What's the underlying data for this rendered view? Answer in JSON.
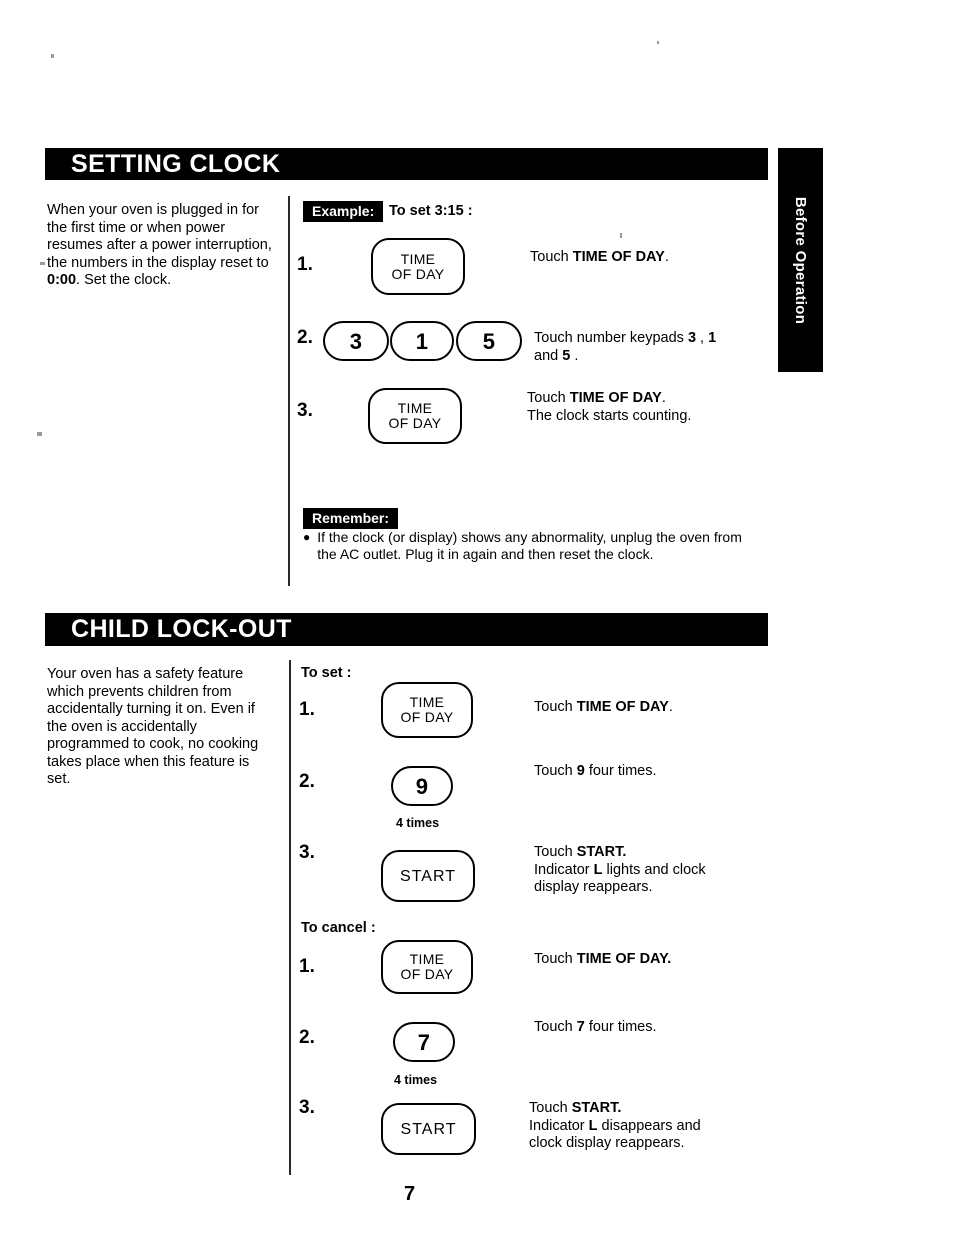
{
  "page": {
    "number": "7",
    "side_tab": "Before Operation"
  },
  "sections": [
    {
      "id": "setting-clock",
      "title": "SETTING CLOCK",
      "intro_html": "When your oven is plugged in for the first time or when power resumes after a power interruption, the numbers in the display reset to <b>0:00</b>. Set the clock.",
      "example_chip": "Example:",
      "example_text": "To set 3:15 :",
      "steps": [
        {
          "num": "1.",
          "keys": [
            {
              "type": "rect",
              "label_line1": "TIME",
              "label_line2": "OF DAY"
            }
          ],
          "desc_html": "Touch <b>TIME OF DAY</b>."
        },
        {
          "num": "2.",
          "keys": [
            {
              "type": "pill",
              "label_line1": "3"
            },
            {
              "type": "pill",
              "label_line1": "1"
            },
            {
              "type": "pill",
              "label_line1": "5"
            }
          ],
          "desc_html": "Touch number keypads <b>3</b> , <b>1</b><br>and <b>5</b> ."
        },
        {
          "num": "3.",
          "keys": [
            {
              "type": "rect",
              "label_line1": "TIME",
              "label_line2": "OF DAY"
            }
          ],
          "desc_html": "Touch <b>TIME OF DAY</b>.<br>The clock starts counting."
        }
      ],
      "remember_chip": "Remember:",
      "remember_bullet": "If the clock (or display) shows any abnormality, unplug the oven from the AC outlet. Plug it in again and then reset the clock."
    },
    {
      "id": "child-lock-out",
      "title": "CHILD LOCK-OUT",
      "intro_html": "Your oven has a safety feature which prevents children from accidentally turning it on. Even if the oven is accidentally programmed to cook, no cooking takes place when this feature is set.",
      "to_set_label": "To set :",
      "to_set_steps": [
        {
          "num": "1.",
          "keys": [
            {
              "type": "rect",
              "label_line1": "TIME",
              "label_line2": "OF DAY"
            }
          ],
          "desc_html": "Touch <b>TIME OF DAY</b>."
        },
        {
          "num": "2.",
          "keys": [
            {
              "type": "pill",
              "label_line1": "9"
            }
          ],
          "times": "4 times",
          "desc_html": "Touch <b>9</b>  four times."
        },
        {
          "num": "3.",
          "keys": [
            {
              "type": "start",
              "label_line1": "START"
            }
          ],
          "desc_html": "Touch <b>START.</b><br>Indicator <b>L</b> lights and clock<br>display reappears."
        }
      ],
      "to_cancel_label": "To cancel :",
      "to_cancel_steps": [
        {
          "num": "1.",
          "keys": [
            {
              "type": "rect",
              "label_line1": "TIME",
              "label_line2": "OF DAY"
            }
          ],
          "desc_html": "Touch <b>TIME OF DAY.</b>"
        },
        {
          "num": "2.",
          "keys": [
            {
              "type": "pill",
              "label_line1": "7"
            }
          ],
          "times": "4 times",
          "desc_html": "Touch <b>7</b>  four times."
        },
        {
          "num": "3.",
          "keys": [
            {
              "type": "start",
              "label_line1": "START"
            }
          ],
          "desc_html": "Touch <b>START.</b><br>Indicator <b>L</b> disappears and<br>clock display reappears."
        }
      ]
    }
  ],
  "colors": {
    "ink": "#000000",
    "paper": "#ffffff"
  }
}
